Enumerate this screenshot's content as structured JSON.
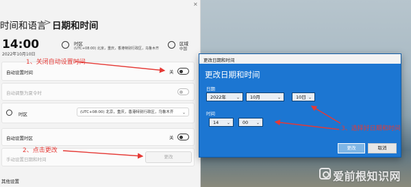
{
  "settings": {
    "breadcrumb_parent": "时间和语言",
    "breadcrumb_sep": ">",
    "breadcrumb_current": "日期和时间",
    "current_time": "14:00",
    "current_date": "2022年10月10日",
    "timezone_header": "时区",
    "timezone_value": "(UTC+08:00) 北京，重庆，香港特别行政区，乌鲁木齐",
    "region_header": "区域",
    "region_value": "中国",
    "auto_time_label": "自动设置时间",
    "auto_time_state": "关",
    "auto_dst_label": "自动调整为夏令时",
    "timezone_row_label": "时区",
    "timezone_select_value": "(UTC+08:00) 北京，重庆，香港特别行政区，乌鲁木齐",
    "auto_tz_label": "自动设置时区",
    "auto_tz_state": "关",
    "manual_label": "手动设置日期和时间",
    "change_button": "更改",
    "more_section": "其他设置"
  },
  "annotations": {
    "step1": "1、关闭自动设置时间",
    "step2": "2、点击更改",
    "step3": "3、选择好日期和时间"
  },
  "dialog": {
    "titlebar": "更改日期和时间",
    "heading": "更改日期和时间",
    "date_label": "日期",
    "year": "2022年",
    "month": "10月",
    "day": "10日",
    "time_label": "时间",
    "hour": "14",
    "minute": "00",
    "change_button": "更改",
    "cancel_button": "取消"
  },
  "watermark": {
    "text": "爱前根知识网"
  },
  "colors": {
    "dialog_bg": "#1c76d2",
    "annotation": "#e53935"
  },
  "icons": [
    "globe-icon",
    "region-icon",
    "clock-icon",
    "chevron-down-icon",
    "close-icon"
  ]
}
